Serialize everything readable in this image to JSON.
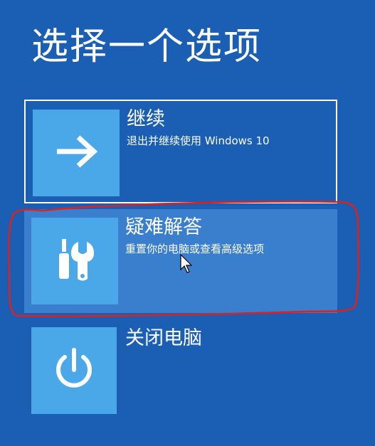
{
  "page": {
    "title": "选择一个选项"
  },
  "options": [
    {
      "title": "继续",
      "description": "退出并继续使用 Windows 10",
      "icon": "arrow-right-icon"
    },
    {
      "title": "疑难解答",
      "description": "重置你的电脑或查看高级选项",
      "icon": "tools-icon"
    },
    {
      "title": "关闭电脑",
      "description": "",
      "icon": "power-icon"
    }
  ],
  "colors": {
    "background": "#1a5fb4",
    "tile": "#4aa8e8",
    "selected_option": "#3a7fcd",
    "annotation": "#e0201b"
  }
}
